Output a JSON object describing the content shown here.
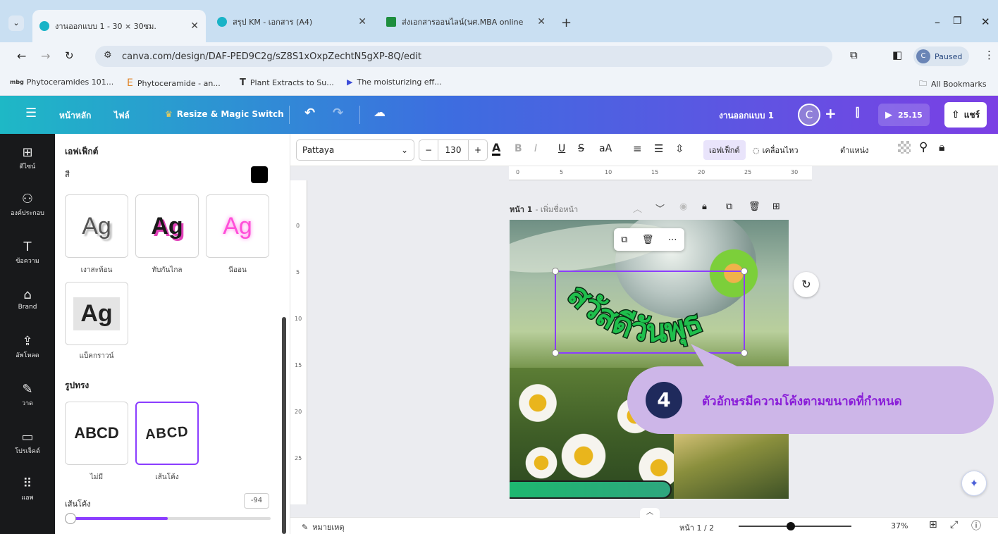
{
  "browser": {
    "tabs": [
      {
        "title": "งานออกแบบ 1 - 30 × 30ซม.",
        "active": true
      },
      {
        "title": "สรุป KM - เอกสาร (A4)",
        "active": false
      },
      {
        "title": "ส่งเอกสารออนไลน์(นศ.MBA online",
        "active": false
      }
    ],
    "new_tab": "+",
    "url": "canva.com/design/DAF-PED9C2g/sZ8S1xOxpZechtN5gXP-8Q/edit",
    "profile_status": "Paused",
    "profile_initial": "C",
    "bookmarks": [
      "Phytoceramides 101...",
      "Phytoceramide - an...",
      "Plant Extracts to Su...",
      "The moisturizing eff..."
    ],
    "bookmark_prefixes": [
      "mbg",
      "E",
      "T",
      "▶"
    ],
    "all_bookmarks": "All Bookmarks"
  },
  "canva_bar": {
    "home": "หน้าหลัก",
    "file": "ไฟล์",
    "resize": "Resize & Magic Switch",
    "doc_name": "งานออกแบบ 1",
    "user_initial": "C",
    "timer": "25.15",
    "share": "แชร์"
  },
  "rail": [
    {
      "label": "ดีไซน์",
      "icon": "⊞"
    },
    {
      "label": "องค์ประกอบ",
      "icon": "⚇"
    },
    {
      "label": "ข้อความ",
      "icon": "T"
    },
    {
      "label": "Brand",
      "icon": "⌂"
    },
    {
      "label": "อัพโหลด",
      "icon": "⇪"
    },
    {
      "label": "วาด",
      "icon": "✎"
    },
    {
      "label": "โปรเจ็คต์",
      "icon": "▭"
    },
    {
      "label": "แอพ",
      "icon": "⠿"
    }
  ],
  "panel": {
    "title": "เอฟเฟ็กต์",
    "color_label": "สี",
    "effects": [
      {
        "label": "เงาสะท้อน",
        "sample": "Ag"
      },
      {
        "label": "ทับกันไกล",
        "sample": "Ag"
      },
      {
        "label": "นีออน",
        "sample": "Ag"
      },
      {
        "label": "แบ็คกราวน์",
        "sample": "Ag"
      }
    ],
    "shape_heading": "รูปทรง",
    "shapes": [
      {
        "label": "ไม่มี",
        "sample": "ABCD"
      },
      {
        "label": "เส้นโค้ง",
        "sample": "ABCD"
      }
    ],
    "curve_label": "เส้นโค้ง",
    "curve_value": "-94"
  },
  "text_toolbar": {
    "font": "Pattaya",
    "size": "130",
    "minus": "−",
    "plus": "+",
    "effects_btn": "เอฟเฟ็กต์",
    "animate_btn": "เคลื่อนไหว",
    "position_btn": "ตำแหน่ง"
  },
  "ruler_top_ticks": [
    "0",
    "5",
    "10",
    "15",
    "20",
    "25",
    "30"
  ],
  "ruler_left_ticks": [
    "0",
    "5",
    "10",
    "15",
    "20",
    "25"
  ],
  "page": {
    "label": "หน้า 1",
    "add_title": "- เพิ่มชื่อหน้า",
    "curved_text": "สวัสดีวันพุธ"
  },
  "callout": {
    "number": "4",
    "text": "ตัวอักษรมีความโค้งตามขนาดที่กำหนด"
  },
  "bottom": {
    "notes": "หมายเหตุ",
    "page_count": "หน้า 1 / 2",
    "zoom": "37%"
  },
  "colors": {
    "accent": "#8b3dff",
    "callout_bg": "#cdb6e8",
    "callout_text": "#8a1ed8",
    "badge_bg": "#1f2a5c",
    "curved_text": "#1fbf4c"
  }
}
